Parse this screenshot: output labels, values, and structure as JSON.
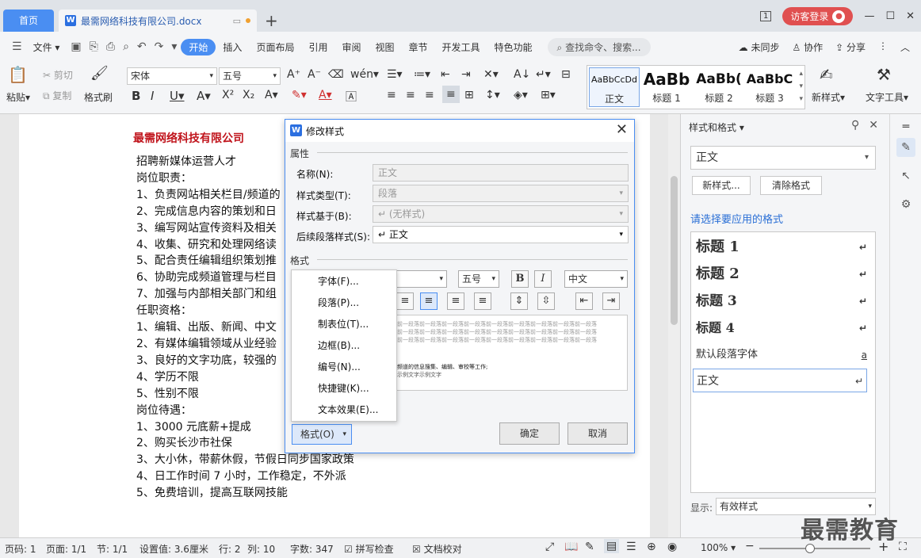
{
  "titlebar": {
    "home_tab": "首页",
    "doc_tab": "最需网络科技有限公司.docx",
    "login": "访客登录",
    "page_num_icon": "1"
  },
  "menubar": {
    "file": "文件",
    "items": [
      "开始",
      "插入",
      "页面布局",
      "引用",
      "审阅",
      "视图",
      "章节",
      "开发工具",
      "特色功能"
    ],
    "search": "查找命令、搜索...",
    "right": [
      "未同步",
      "协作",
      "分享"
    ]
  },
  "ribbon": {
    "paste": "粘贴",
    "cut": "剪切",
    "copy": "复制",
    "format_painter": "格式刷",
    "font_name": "宋体",
    "font_size": "五号",
    "styles": [
      {
        "preview": "AaBbCcDd",
        "label": "正文"
      },
      {
        "preview": "AaBb",
        "label": "标题 1"
      },
      {
        "preview": "AaBb(",
        "label": "标题 2"
      },
      {
        "preview": "AaBbC",
        "label": "标题 3"
      }
    ],
    "new_style": "新样式",
    "text_tools": "文字工具"
  },
  "document": {
    "title": "最需网络科技有限公司",
    "lines": [
      "招聘新媒体运营人才",
      "岗位职责：",
      "1、负责网站相关栏目/频道的",
      "2、完成信息内容的策划和日",
      "3、编写网站宣传资料及相关",
      "4、收集、研究和处理网络读",
      "5、配合责任编辑组织策划推",
      "6、协助完成频道管理与栏目",
      "7、加强与内部相关部门和组",
      "任职资格：",
      "1、编辑、出版、新闻、中文",
      "2、有媒体编辑领域从业经验",
      "3、良好的文字功底，较强的",
      "4、学历不限",
      "5、性别不限",
      "岗位待遇：",
      "1、3000 元底薪+提成",
      "2、购买长沙市社保",
      "3、大小休，带薪休假，节假日同步国家政策",
      "4、日工作时间 7 小时，工作稳定，不外派",
      "5、免费培训，提高互联网技能"
    ]
  },
  "dialog": {
    "title": "修改样式",
    "section_props": "属性",
    "name_label": "名称(N):",
    "name_value": "正文",
    "type_label": "样式类型(T):",
    "type_value": "段落",
    "based_label": "样式基于(B):",
    "based_value": "↵ (无样式)",
    "next_label": "后续段落样式(S):",
    "next_value": "↵ 正文",
    "section_format": "格式",
    "size_value": "五号",
    "lang_value": "中文",
    "bold": "B",
    "italic": "I",
    "preview_gray": "前一段落前一段落前一段落前一段落前一段落前一段落前一段落前一段落前一段落",
    "preview_dark_1": "频道的信息搜集、编辑、审校等工作;",
    "preview_dark_2": "示例文字示例文字",
    "format_button": "格式(O)",
    "ok": "确定",
    "cancel": "取消"
  },
  "dropdown": {
    "items": [
      "字体(F)...",
      "段落(P)...",
      "制表位(T)...",
      "边框(B)...",
      "编号(N)...",
      "快捷键(K)...",
      "文本效果(E)..."
    ]
  },
  "pane": {
    "title": "样式和格式",
    "current": "正文",
    "new_style_btn": "新样式...",
    "clear_btn": "清除格式",
    "hint": "请选择要应用的格式",
    "styles": [
      {
        "label": "标题  1",
        "mark": "↵"
      },
      {
        "label": "标题  2",
        "mark": "↵"
      },
      {
        "label": "标题  3",
        "mark": "↵"
      },
      {
        "label": "标题  4",
        "mark": "↵"
      },
      {
        "label": "默认段落字体",
        "mark": "a"
      },
      {
        "label": "正文",
        "mark": "↵"
      }
    ],
    "show_label": "显示:",
    "show_value": "有效样式"
  },
  "statusbar": {
    "page": "页码: 1",
    "pages": "页面: 1/1",
    "section": "节: 1/1",
    "setting": "设置值: 3.6厘米",
    "row": "行: 2",
    "col": "列: 10",
    "words": "字数: 347",
    "spell": "拼写检查",
    "proof": "文档校对",
    "zoom": "100%",
    "zoom_level": 0.46
  },
  "watermark": "最需教育"
}
